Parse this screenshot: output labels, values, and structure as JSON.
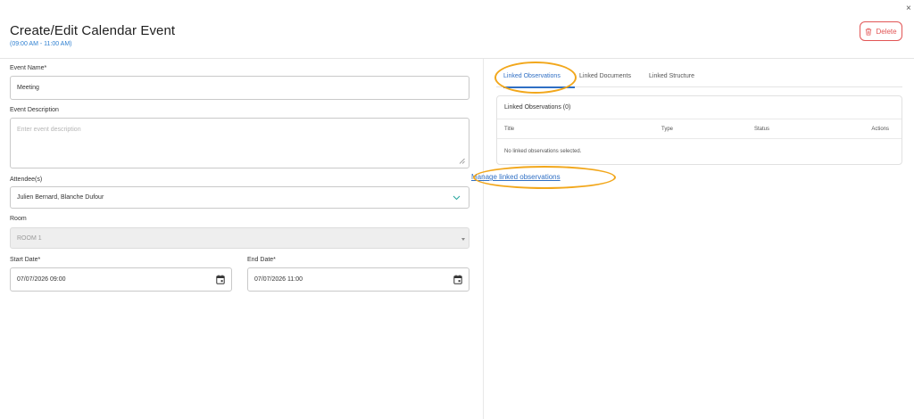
{
  "header": {
    "title": "Create/Edit Calendar Event",
    "subtitle": "(09:00 AM - 11:00 AM)",
    "close_glyph": "×",
    "delete_label": "Delete",
    "delete_icon": "trash-icon"
  },
  "form": {
    "event_name": {
      "label": "Event Name*",
      "value": "Meeting"
    },
    "event_description": {
      "label": "Event Description",
      "placeholder": "Enter event description"
    },
    "attendees": {
      "label": "Attendee(s)",
      "value": "Julien Bernard, Blanche Dufour"
    },
    "room": {
      "label": "Room",
      "value": "ROOM 1"
    },
    "start_date": {
      "label": "Start Date*",
      "value": "07/07/2026 09:00"
    },
    "end_date": {
      "label": "End Date*",
      "value": "07/07/2026 11:00"
    }
  },
  "tabs": [
    {
      "label": "Linked Observations",
      "active": true
    },
    {
      "label": "Linked Documents",
      "active": false
    },
    {
      "label": "Linked Structure",
      "active": false
    }
  ],
  "linked_observations": {
    "title": "Linked Observations (0)",
    "columns": [
      "Title",
      "Type",
      "Status",
      "Actions"
    ],
    "empty_message": "No linked observations selected.",
    "manage_link": "Manage linked observations"
  },
  "colors": {
    "accent": "#2f6fc4",
    "delete": "#e25555",
    "highlight": "#f2a71b"
  }
}
